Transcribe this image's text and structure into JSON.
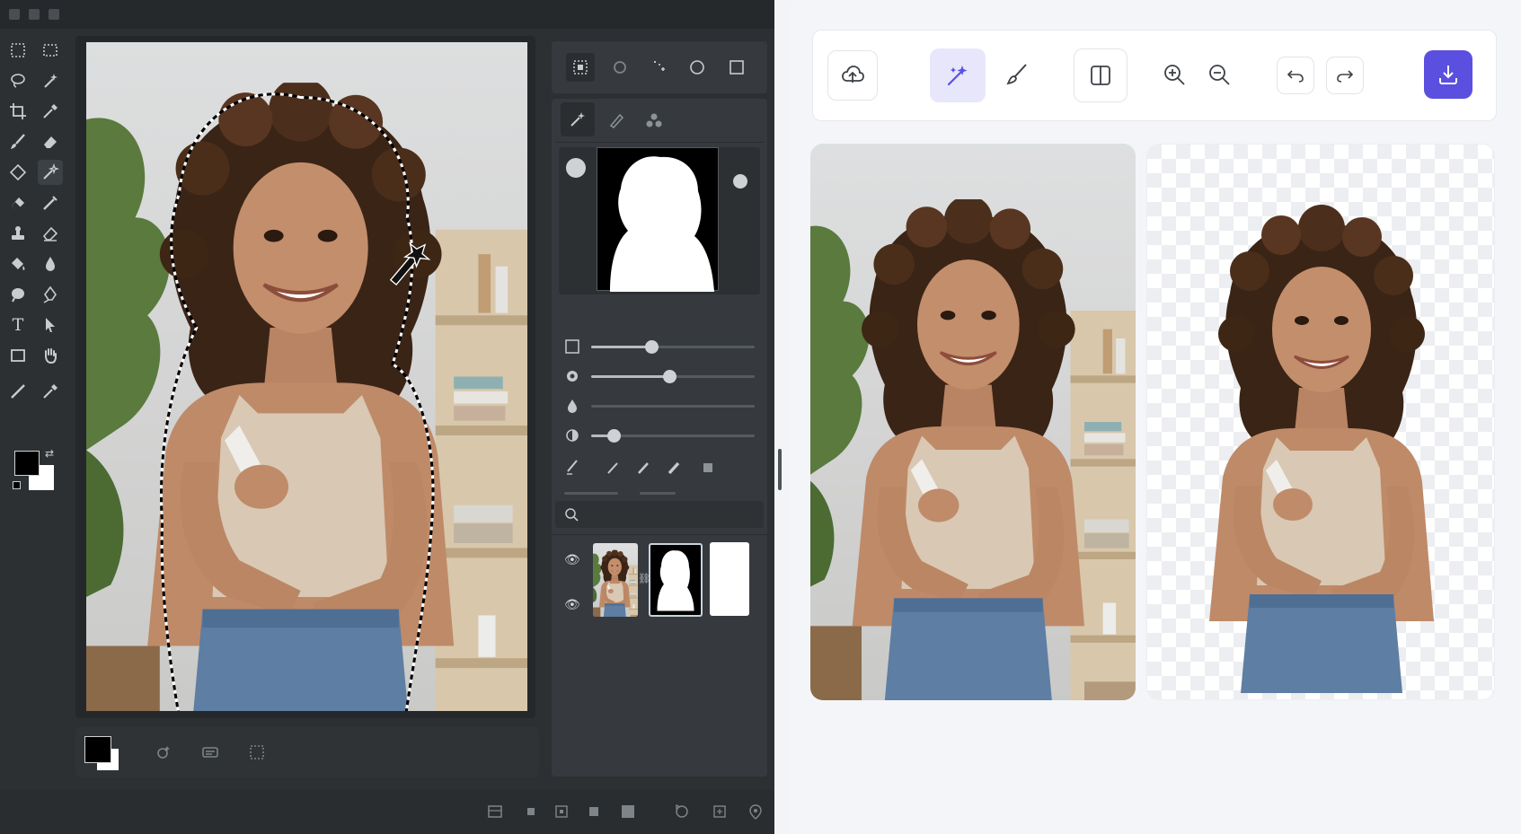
{
  "editor": {
    "window_controls": [
      "minimize",
      "maximize",
      "close"
    ],
    "tools": [
      {
        "name": "rect-marquee-icon"
      },
      {
        "name": "marquee-icon"
      },
      {
        "name": "lasso-icon"
      },
      {
        "name": "magic-wand-icon"
      },
      {
        "name": "crop-icon"
      },
      {
        "name": "eyedropper-icon"
      },
      {
        "name": "brush-icon"
      },
      {
        "name": "eraser-icon"
      },
      {
        "name": "diamond-icon"
      },
      {
        "name": "magic-select-icon",
        "active": true
      },
      {
        "name": "eraser-alt-icon"
      },
      {
        "name": "smudge-icon"
      },
      {
        "name": "stamp-icon"
      },
      {
        "name": "bg-eraser-icon"
      },
      {
        "name": "paint-bucket-icon"
      },
      {
        "name": "drop-icon"
      },
      {
        "name": "blur-icon"
      },
      {
        "name": "pen-icon"
      },
      {
        "name": "type-tool-icon",
        "text": "T"
      },
      {
        "name": "path-select-icon"
      },
      {
        "name": "rectangle-icon"
      },
      {
        "name": "hand-icon"
      },
      {
        "name": "line-icon"
      },
      {
        "name": "color-sampler-icon"
      }
    ],
    "foreground_color": "#000000",
    "background_color": "#ffffff",
    "selection_modes": [
      "rect-select-icon",
      "lasso-select-icon",
      "point-select-icon",
      "ellipse-select-icon",
      "square-select-icon"
    ],
    "mask_tools": [
      "wand-icon",
      "refine-brush-icon",
      "subject-icon"
    ],
    "refine_sliders": [
      {
        "icon": "checkbox-icon",
        "value": 0.37
      },
      {
        "icon": "smooth-icon",
        "value": 0.48
      },
      {
        "icon": "feather-icon",
        "value": 0.0
      },
      {
        "icon": "contrast-icon",
        "value": 0.14
      }
    ],
    "layers": [
      {
        "visible": true,
        "type": "photo"
      },
      {
        "visible": true,
        "type": "mask"
      }
    ]
  },
  "webapp": {
    "toolbar": {
      "upload": "upload-icon",
      "ai_remove": "magic-icon",
      "brush": "brush-icon",
      "compare": "compare-icon",
      "zoom_in": "zoom-in-icon",
      "zoom_out": "zoom-out-icon",
      "undo": "undo-icon",
      "redo": "redo-icon",
      "download": "download-icon"
    },
    "accent_color": "#5b4fe0",
    "panels": [
      "original",
      "background-removed"
    ]
  }
}
